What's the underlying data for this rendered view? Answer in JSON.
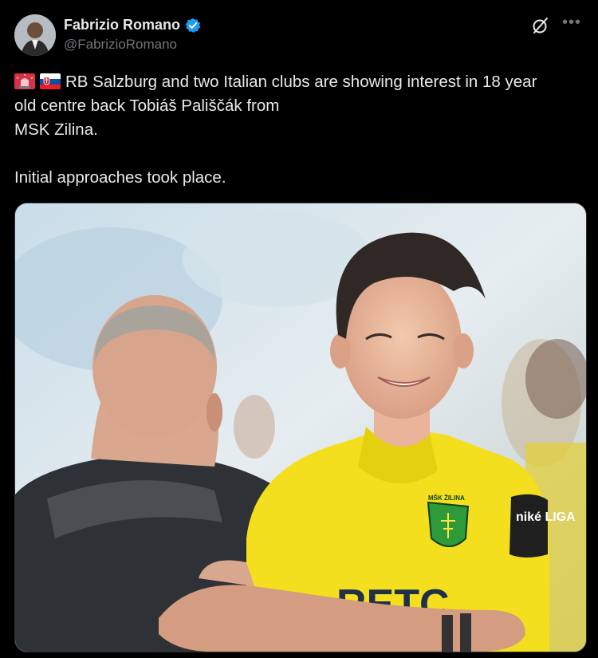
{
  "author": {
    "display_name": "Fabrizio Romano",
    "handle": "@FabrizioRomano"
  },
  "icons": {
    "verified": "verified-badge-icon",
    "grok": "grok-icon",
    "more": "more-options-icon",
    "flag_1": "rotating-light-emoji-icon",
    "flag_2": "slovakia-flag-icon"
  },
  "tweet": {
    "line1": "RB Salzburg and two Italian clubs are showing interest in 18 year",
    "line2": "old centre back Tobiáš Pališčák from",
    "line3": "MSK Zilina.",
    "line4": "Initial approaches took place."
  },
  "photo": {
    "badge_text": "MŠK ŽILINA",
    "shirt_text": "RETC",
    "sleeve_text": "niké LIGA"
  },
  "colors": {
    "background": "#000000",
    "text": "#e7e9ea",
    "secondary": "#71767b",
    "verified": "#1d9bf0",
    "jersey": "#f5e31a"
  }
}
